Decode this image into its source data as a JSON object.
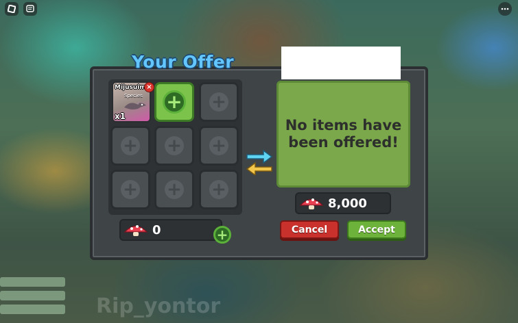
{
  "top_bar": {
    "roblox_icon": "roblox-logo-icon",
    "chat_icon": "chat-icon",
    "menu_icon": "more-menu-icon"
  },
  "trade": {
    "title": "Your Offer",
    "my_offer": {
      "item": {
        "name": "Mijusuim",
        "subtitle": "Species",
        "quantity": "x1"
      },
      "currency_amount": "0"
    },
    "their_offer": {
      "empty_message_line1": "No items have",
      "empty_message_line2": "been offered!",
      "currency_amount": "8,000"
    },
    "buttons": {
      "cancel": "Cancel",
      "accept": "Accept"
    }
  },
  "colors": {
    "title": "#63c6ff",
    "cancel": "#c9312c",
    "accept": "#6db23a",
    "their_panel": "#7ba84b"
  },
  "background_text": "Rip_yontor"
}
